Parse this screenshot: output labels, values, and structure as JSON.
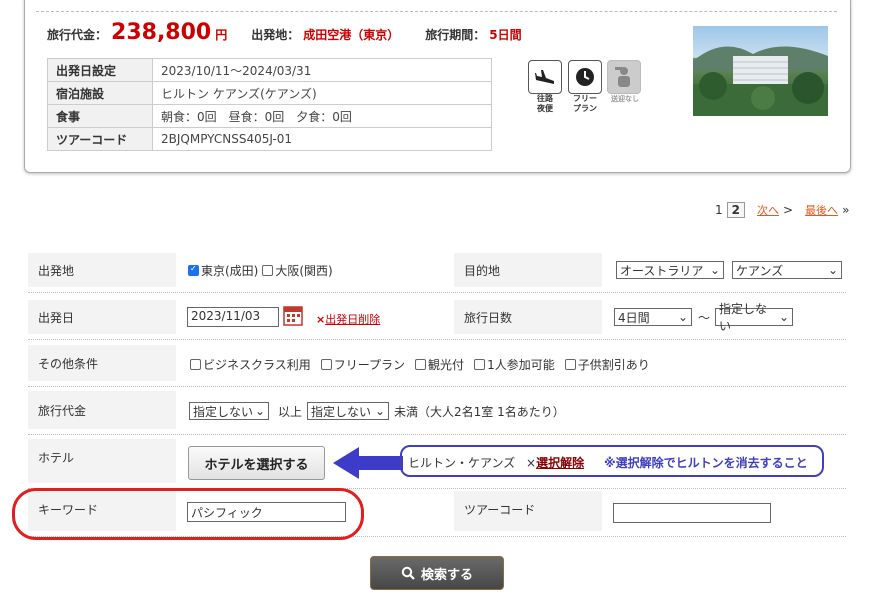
{
  "tour": {
    "price_label": "旅行代金：",
    "price": "238,800",
    "price_unit": "円",
    "departure_label": "出発地：",
    "departure": "成田空港（東京）",
    "period_label": "旅行期間：",
    "period": "5日間",
    "rows": [
      {
        "label": "出発日設定",
        "value": "2023/10/11〜2024/03/31"
      },
      {
        "label": "宿泊施設",
        "value": "ヒルトン ケアンズ(ケアンズ)"
      },
      {
        "label": "食事",
        "value": "朝食：0回　昼食：0回　夕食：0回"
      },
      {
        "label": "ツアーコード",
        "value": "2BJQMPYCNSS405J-01"
      }
    ],
    "icons": [
      {
        "name": "airplane-icon",
        "caption1": "往路",
        "caption2": "夜便"
      },
      {
        "name": "clock-icon",
        "caption1": "フリー",
        "caption2": "プラン"
      },
      {
        "name": "guide-icon",
        "caption1": "送迎なし",
        "caption2": ""
      }
    ]
  },
  "pager": {
    "page1": "1",
    "page2": "2",
    "next": "次へ",
    "next_arrow": ">",
    "last": "最後へ",
    "last_arrow": "»"
  },
  "form": {
    "departure_label": "出発地",
    "dep_opt1": "東京(成田)",
    "dep_opt2": "大阪(関西)",
    "dest_label": "目的地",
    "dest_country": "オーストラリア",
    "dest_city": "ケアンズ",
    "date_label": "出発日",
    "date_value": "2023/11/03",
    "date_clear_x": "×",
    "date_clear": "出発日削除",
    "days_label": "旅行日数",
    "days_from": "4日間",
    "days_sep": "〜",
    "days_to": "指定しない",
    "other_label": "その他条件",
    "other_opts": [
      "ビジネスクラス利用",
      "フリープラン",
      "観光付",
      "1人参加可能",
      "子供割引あり"
    ],
    "price_label": "旅行代金",
    "price_min": "指定しない",
    "price_ijo": "以上",
    "price_max": "指定しない",
    "price_note": "未満（大人2名1室 1名あたり）",
    "hotel_label": "ホテル",
    "hotel_button": "ホテルを選択する",
    "hotel_selected": "ヒルトン・ケアンズ",
    "hotel_clear_x": "×",
    "hotel_clear": "選択解除",
    "hotel_note": "※選択解除でヒルトンを消去すること",
    "keyword_label": "キーワード",
    "keyword_value": "パシフィック",
    "tourcode_label": "ツアーコード",
    "tourcode_value": "",
    "search_button": "検索する"
  },
  "colors": {
    "accent_red": "#cc0000",
    "annotation_blue": "#3f3fbf",
    "highlight_red": "#e02020",
    "search_btn": "#555555"
  }
}
